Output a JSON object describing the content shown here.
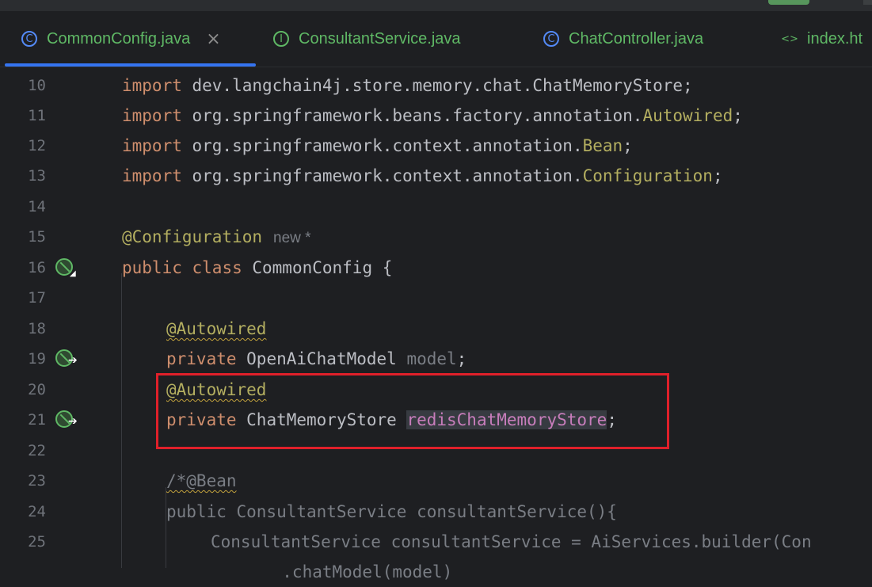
{
  "tabs": [
    {
      "label": "CommonConfig.java",
      "icon": "class-icon",
      "active": true,
      "close": "×"
    },
    {
      "label": "ConsultantService.java",
      "icon": "interface-icon"
    },
    {
      "label": "ChatController.java",
      "icon": "class-icon"
    },
    {
      "label": "index.ht",
      "icon": "html-icon"
    }
  ],
  "icons": {
    "class_glyph": "C",
    "interface_glyph": "I",
    "html_glyph": "<>"
  },
  "lines": [
    {
      "n": "10"
    },
    {
      "n": "11"
    },
    {
      "n": "12"
    },
    {
      "n": "13"
    },
    {
      "n": "14"
    },
    {
      "n": "15"
    },
    {
      "n": "16"
    },
    {
      "n": "17"
    },
    {
      "n": "18"
    },
    {
      "n": "19"
    },
    {
      "n": "20"
    },
    {
      "n": "21"
    },
    {
      "n": "22"
    },
    {
      "n": "23"
    },
    {
      "n": "24"
    },
    {
      "n": "25"
    }
  ],
  "code": {
    "l10": {
      "kw": "import",
      "rest": " dev.langchain4j.store.memory.chat.ChatMemoryStore;"
    },
    "l11": {
      "kw": "import",
      "rest": " org.springframework.beans.factory.annotation.",
      "ann": "Autowired",
      "end": ";"
    },
    "l12": {
      "kw": "import",
      "rest": " org.springframework.context.annotation.",
      "ann": "Bean",
      "end": ";"
    },
    "l13": {
      "kw": "import",
      "rest": " org.springframework.context.annotation.",
      "ann": "Configuration",
      "end": ";"
    },
    "l15": {
      "ann": "@Configuration",
      "hint": "new *"
    },
    "l16": {
      "kw1": "public",
      "kw2": "class",
      "rest": " CommonConfig {"
    },
    "l18": {
      "ann": "@Autowired"
    },
    "l19": {
      "kw": "private",
      "type": " OpenAiChatModel ",
      "field": "model",
      "end": ";"
    },
    "l20": {
      "ann": "@Autowired"
    },
    "l21": {
      "kw": "private",
      "type": " ChatMemoryStore ",
      "field": "redisChatMemoryStore",
      "end": ";"
    },
    "l23": {
      "text": "/*@Bean"
    },
    "l24": {
      "text": "public ConsultantService consultantService(){"
    },
    "l25": {
      "text": "ConsultantService consultantService = AiServices.builder(Con"
    },
    "l26": {
      "text": "                .chatModel(model)"
    }
  },
  "colors": {
    "keyword": "#cf8e6d",
    "annotation": "#b3ae60",
    "field": "#c77dbb",
    "highlight_box": "#e0202a",
    "accent": "#3574f0"
  }
}
